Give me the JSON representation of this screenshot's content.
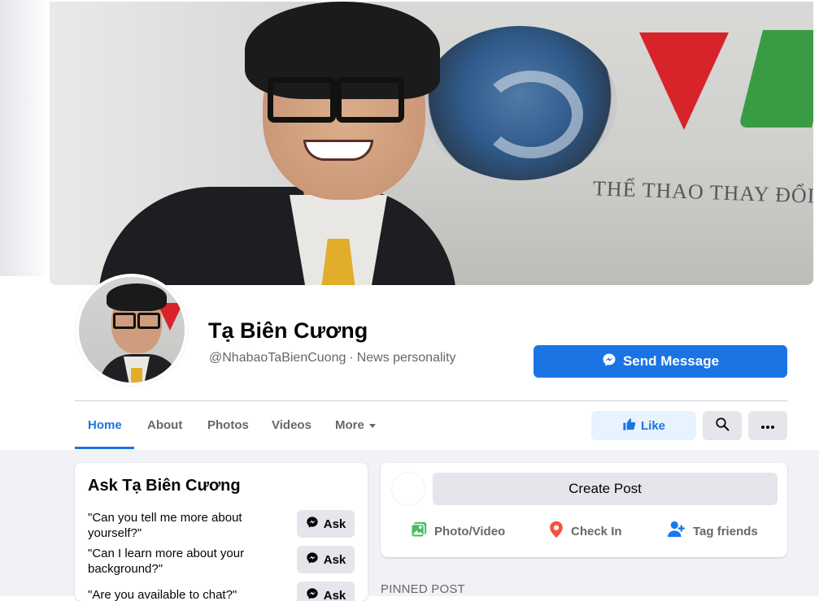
{
  "cover": {
    "slogan": "THỂ THAO THAY ĐỔI"
  },
  "profile": {
    "name": "Tạ Biên Cương",
    "handle": "@NhabaoTaBienCuong",
    "separator": "·",
    "category": "News personality"
  },
  "actions": {
    "send_message": "Send Message",
    "like": "Like"
  },
  "tabs": [
    {
      "label": "Home",
      "active": true
    },
    {
      "label": "About",
      "active": false
    },
    {
      "label": "Photos",
      "active": false
    },
    {
      "label": "Videos",
      "active": false
    },
    {
      "label": "More",
      "active": false
    }
  ],
  "ask": {
    "title": "Ask Tạ Biên Cương",
    "button_label": "Ask",
    "questions": [
      "\"Can you tell me more about yourself?\"",
      "\"Can I learn more about your background?\"",
      "\"Are you available to chat?\""
    ]
  },
  "create_post": {
    "button_label": "Create Post",
    "photo_video": "Photo/Video",
    "check_in": "Check In",
    "tag_friends": "Tag friends"
  },
  "pinned_post": {
    "label": "PINNED POST"
  },
  "colors": {
    "accent": "#1b74e4",
    "like_bg": "#e7f3ff",
    "feed_bg": "#f0f2f5",
    "button_gray": "#e4e6eb",
    "photo_green": "#45bd62",
    "checkin_red": "#f5533d"
  },
  "icons": {
    "messenger": "messenger-icon",
    "thumbs_up": "thumbs-up-icon",
    "search": "search-icon",
    "more": "more-dots-icon",
    "photo": "photo-icon",
    "location": "location-pin-icon",
    "tag": "tag-friends-icon"
  }
}
